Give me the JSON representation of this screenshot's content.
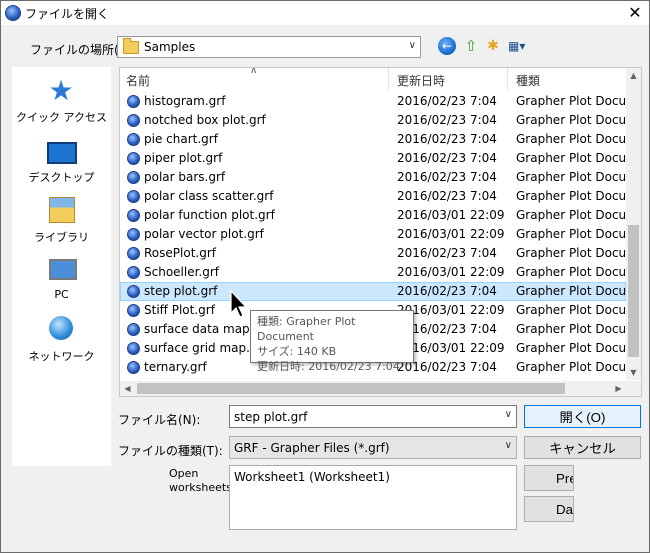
{
  "window": {
    "title": "ファイルを開く",
    "close_glyph": "✕"
  },
  "lookin": {
    "label": "ファイルの場所(I):",
    "value": "Samples"
  },
  "places": [
    {
      "label": "クイック アクセス",
      "icon": "quick-access-icon"
    },
    {
      "label": "デスクトップ",
      "icon": "desktop-icon"
    },
    {
      "label": "ライブラリ",
      "icon": "library-icon"
    },
    {
      "label": "PC",
      "icon": "pc-icon"
    },
    {
      "label": "ネットワーク",
      "icon": "network-icon"
    }
  ],
  "columns": {
    "name": "名前",
    "date": "更新日時",
    "type": "種類"
  },
  "files": [
    {
      "name": "histogram.grf",
      "date": "2016/02/23 7:04",
      "type": "Grapher Plot Docu..."
    },
    {
      "name": "notched box plot.grf",
      "date": "2016/02/23 7:04",
      "type": "Grapher Plot Docu..."
    },
    {
      "name": "pie chart.grf",
      "date": "2016/02/23 7:04",
      "type": "Grapher Plot Docu..."
    },
    {
      "name": "piper plot.grf",
      "date": "2016/02/23 7:04",
      "type": "Grapher Plot Docu..."
    },
    {
      "name": "polar bars.grf",
      "date": "2016/02/23 7:04",
      "type": "Grapher Plot Docu..."
    },
    {
      "name": "polar class scatter.grf",
      "date": "2016/02/23 7:04",
      "type": "Grapher Plot Docu..."
    },
    {
      "name": "polar function plot.grf",
      "date": "2016/03/01 22:09",
      "type": "Grapher Plot Docu..."
    },
    {
      "name": "polar vector plot.grf",
      "date": "2016/03/01 22:09",
      "type": "Grapher Plot Docu..."
    },
    {
      "name": "RosePlot.grf",
      "date": "2016/02/23 7:04",
      "type": "Grapher Plot Docu..."
    },
    {
      "name": "Schoeller.grf",
      "date": "2016/03/01 22:09",
      "type": "Grapher Plot Docu..."
    },
    {
      "name": "step plot.grf",
      "date": "2016/02/23 7:04",
      "type": "Grapher Plot Docu...",
      "selected": true
    },
    {
      "name": "Stiff Plot.grf",
      "date": "2016/03/01 22:09",
      "type": "Grapher Plot Docu..."
    },
    {
      "name": "surface data map.grf",
      "date": "2016/02/23 7:04",
      "type": "Grapher Plot Docu..."
    },
    {
      "name": "surface grid map.grf",
      "date": "2016/03/01 22:09",
      "type": "Grapher Plot Docu..."
    },
    {
      "name": "ternary.grf",
      "date": "2016/02/23 7:04",
      "type": "Grapher Plot Docu..."
    }
  ],
  "tooltip": {
    "line1": "種類: Grapher Plot Document",
    "line2": "サイズ: 140 KB",
    "line3": "更新日時: 2016/02/23 7:04"
  },
  "filename": {
    "label": "ファイル名(N):",
    "value": "step plot.grf"
  },
  "filetype": {
    "label": "ファイルの種類(T):",
    "value": "GRF - Grapher Files (*.grf)"
  },
  "worksheets": {
    "label": "Open worksheets:",
    "value": "Worksheet1 (Worksheet1)"
  },
  "buttons": {
    "open": "開く(O)",
    "cancel": "キャンセル",
    "preview": "Preview",
    "data": "Data"
  },
  "colors": {
    "selection": "#cce8ff",
    "accent": "#0078d7"
  }
}
